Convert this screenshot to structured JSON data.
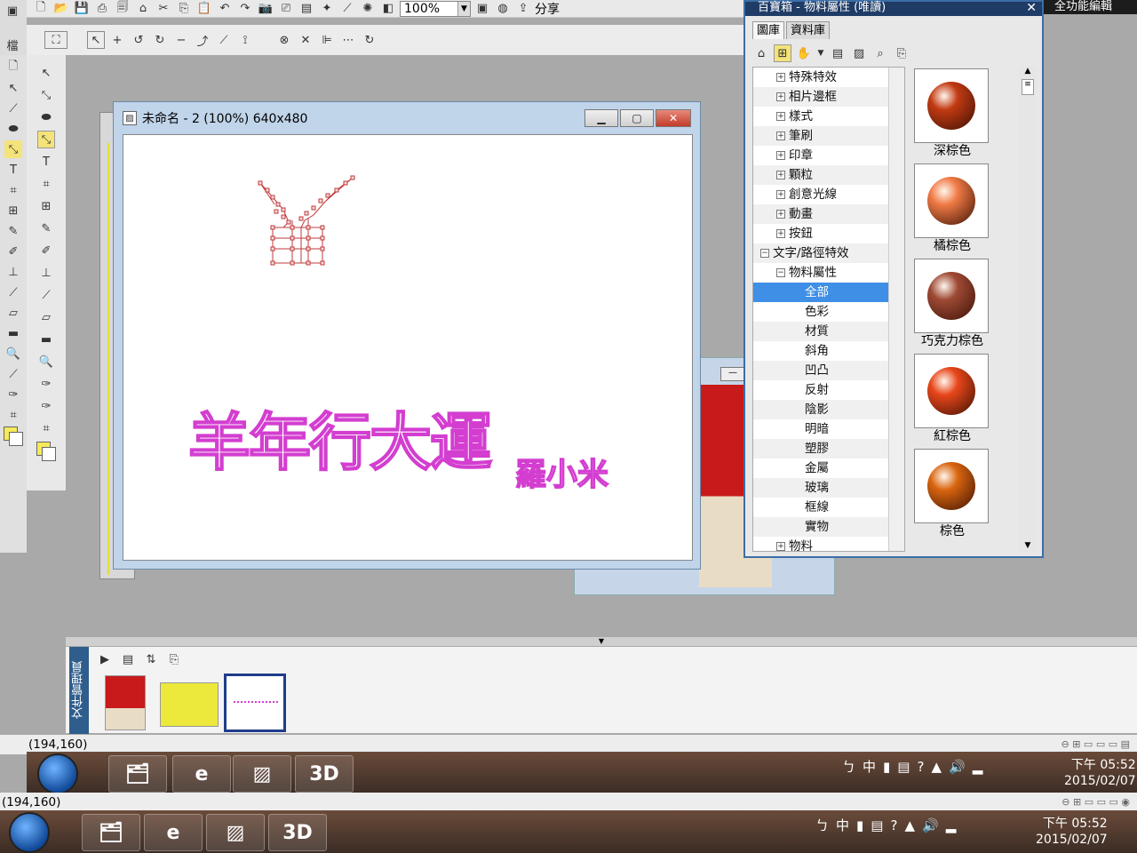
{
  "toolbar": {
    "zoom_value": "100%",
    "share_label": "分享"
  },
  "side_label": "檔",
  "full_function_label": "全功能編輯",
  "document": {
    "title": "未命名 - 2 (100%) 640x480",
    "main_text": "羊年行大運",
    "sub_text": "羅小米"
  },
  "library": {
    "title": "百寶箱 - 物料屬性 (唯讀)",
    "tabs": [
      "圖庫",
      "資料庫"
    ],
    "tree": [
      {
        "label": "特殊特效",
        "level": 1,
        "sign": "+"
      },
      {
        "label": "相片邊框",
        "level": 1,
        "sign": "+"
      },
      {
        "label": "樣式",
        "level": 1,
        "sign": "+"
      },
      {
        "label": "筆刷",
        "level": 1,
        "sign": "+"
      },
      {
        "label": "印章",
        "level": 1,
        "sign": "+"
      },
      {
        "label": "顆粒",
        "level": 1,
        "sign": "+"
      },
      {
        "label": "創意光線",
        "level": 1,
        "sign": "+"
      },
      {
        "label": "動畫",
        "level": 1,
        "sign": "+"
      },
      {
        "label": "按鈕",
        "level": 1,
        "sign": "+"
      },
      {
        "label": "文字/路徑特效",
        "level": 0,
        "sign": "−"
      },
      {
        "label": "物料屬性",
        "level": 1,
        "sign": "−"
      },
      {
        "label": "全部",
        "level": 2,
        "selected": true
      },
      {
        "label": "色彩",
        "level": 2
      },
      {
        "label": "材質",
        "level": 2
      },
      {
        "label": "斜角",
        "level": 2
      },
      {
        "label": "凹凸",
        "level": 2
      },
      {
        "label": "反射",
        "level": 2
      },
      {
        "label": "陰影",
        "level": 2
      },
      {
        "label": "明暗",
        "level": 2
      },
      {
        "label": "塑膠",
        "level": 2
      },
      {
        "label": "金屬",
        "level": 2
      },
      {
        "label": "玻璃",
        "level": 2
      },
      {
        "label": "框線",
        "level": 2
      },
      {
        "label": "實物",
        "level": 2
      },
      {
        "label": "物料",
        "level": 1,
        "sign": "+"
      }
    ],
    "swatches": [
      {
        "name": "深棕色",
        "color": "#c23a12"
      },
      {
        "name": "橘棕色",
        "color": "#f07a45"
      },
      {
        "name": "巧克力棕色",
        "color": "#9e4a35"
      },
      {
        "name": "紅棕色",
        "color": "#e8461a"
      },
      {
        "name": "棕色",
        "color": "#d9650f"
      }
    ]
  },
  "doc_manager": {
    "label": "文件管理員"
  },
  "status": {
    "coords_top": "(194,160)",
    "coords_bottom": "(194,160)"
  },
  "taskbar": {
    "ime_items": [
      "ㄅ",
      "中"
    ],
    "clock_time_top": "下午 05:52",
    "clock_date_top": "2015/02/07",
    "clock_time_bottom": "下午 05:52",
    "clock_date_bottom": "2015/02/07",
    "app_3d_label": "3D"
  },
  "colors": {
    "accent": "#3f8fe6",
    "text_outline": "#d33ed0",
    "path_color": "#c0393b",
    "foreground_swatch": "#f5ea5a"
  }
}
